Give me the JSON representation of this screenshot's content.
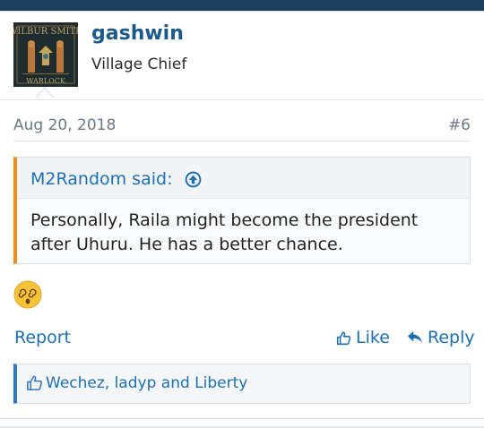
{
  "post": {
    "username": "gashwin",
    "user_title": "Village Chief",
    "avatar": {
      "top_text": "WILBUR SMITH",
      "bottom_text": "WARLOCK"
    },
    "date": "Aug 20, 2018",
    "post_number": "#6"
  },
  "quote": {
    "author": "M2Random said:",
    "text": "Personally, Raila might become the president after Uhuru. He has a better chance."
  },
  "reaction": {
    "emoji": "dizzy-face-emoji"
  },
  "actions": {
    "report": "Report",
    "like": "Like",
    "reply": "Reply"
  },
  "likes": {
    "text": "Wechez, ladyp and Liberty"
  },
  "colors": {
    "link": "#1d6fb4",
    "username": "#1d5a8c",
    "quote_accent": "#f28b18",
    "likes_accent": "#2f78c4",
    "topbar": "#1d3e5c"
  }
}
